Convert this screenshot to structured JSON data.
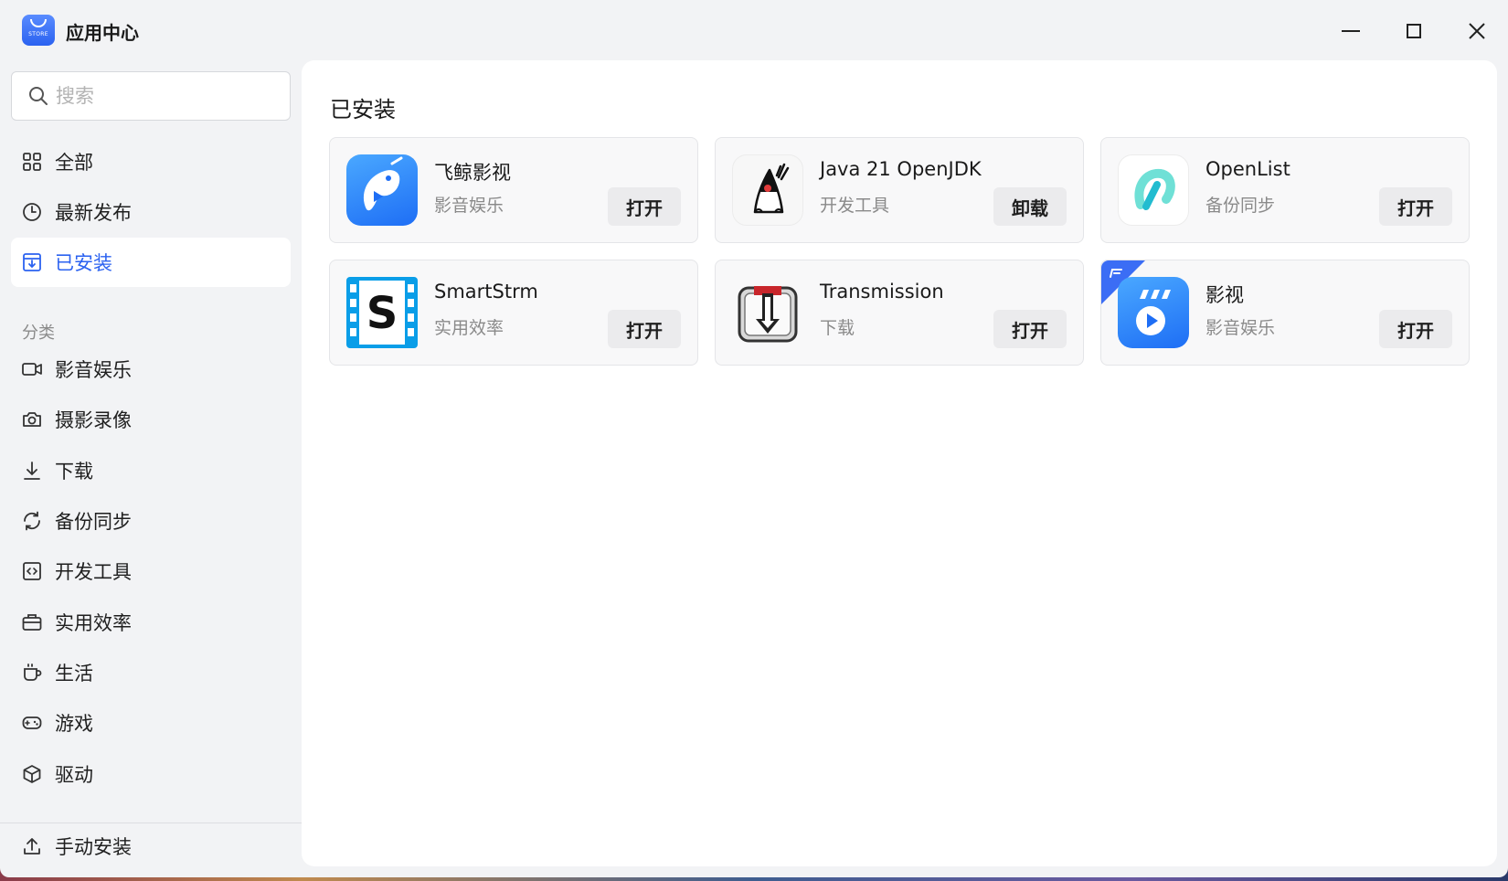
{
  "window": {
    "title": "应用中心",
    "logo_text": "STORE"
  },
  "search": {
    "placeholder": "搜索",
    "value": ""
  },
  "nav": [
    {
      "label": "全部",
      "icon": "grid-icon",
      "active": false
    },
    {
      "label": "最新发布",
      "icon": "clock-icon",
      "active": false
    },
    {
      "label": "已安装",
      "icon": "installed-icon",
      "active": true
    }
  ],
  "categories_label": "分类",
  "categories": [
    {
      "label": "影音娱乐",
      "icon": "video-camera-icon"
    },
    {
      "label": "摄影录像",
      "icon": "camera-icon"
    },
    {
      "label": "下载",
      "icon": "download-icon"
    },
    {
      "label": "备份同步",
      "icon": "sync-icon"
    },
    {
      "label": "开发工具",
      "icon": "code-icon"
    },
    {
      "label": "实用效率",
      "icon": "toolbox-icon"
    },
    {
      "label": "生活",
      "icon": "cup-icon"
    },
    {
      "label": "游戏",
      "icon": "gamepad-icon"
    },
    {
      "label": "驱动",
      "icon": "cube-icon"
    }
  ],
  "manual_install": {
    "label": "手动安装",
    "icon": "upload-icon"
  },
  "main": {
    "title": "已安装",
    "apps": [
      {
        "name": "飞鲸影视",
        "category": "影音娱乐",
        "action": "打开",
        "icon": "narwhal-app-icon"
      },
      {
        "name": "Java 21 OpenJDK",
        "category": "开发工具",
        "action": "卸载",
        "icon": "java-duke-app-icon"
      },
      {
        "name": "OpenList",
        "category": "备份同步",
        "action": "打开",
        "icon": "openlist-app-icon"
      },
      {
        "name": "SmartStrm",
        "category": "实用效率",
        "action": "打开",
        "icon": "smartstrm-app-icon"
      },
      {
        "name": "Transmission",
        "category": "下载",
        "action": "打开",
        "icon": "transmission-app-icon"
      },
      {
        "name": "影视",
        "category": "影音娱乐",
        "action": "打开",
        "icon": "yingshi-app-icon"
      }
    ]
  },
  "colors": {
    "accent": "#2b62f0",
    "background": "#f2f3f5"
  }
}
